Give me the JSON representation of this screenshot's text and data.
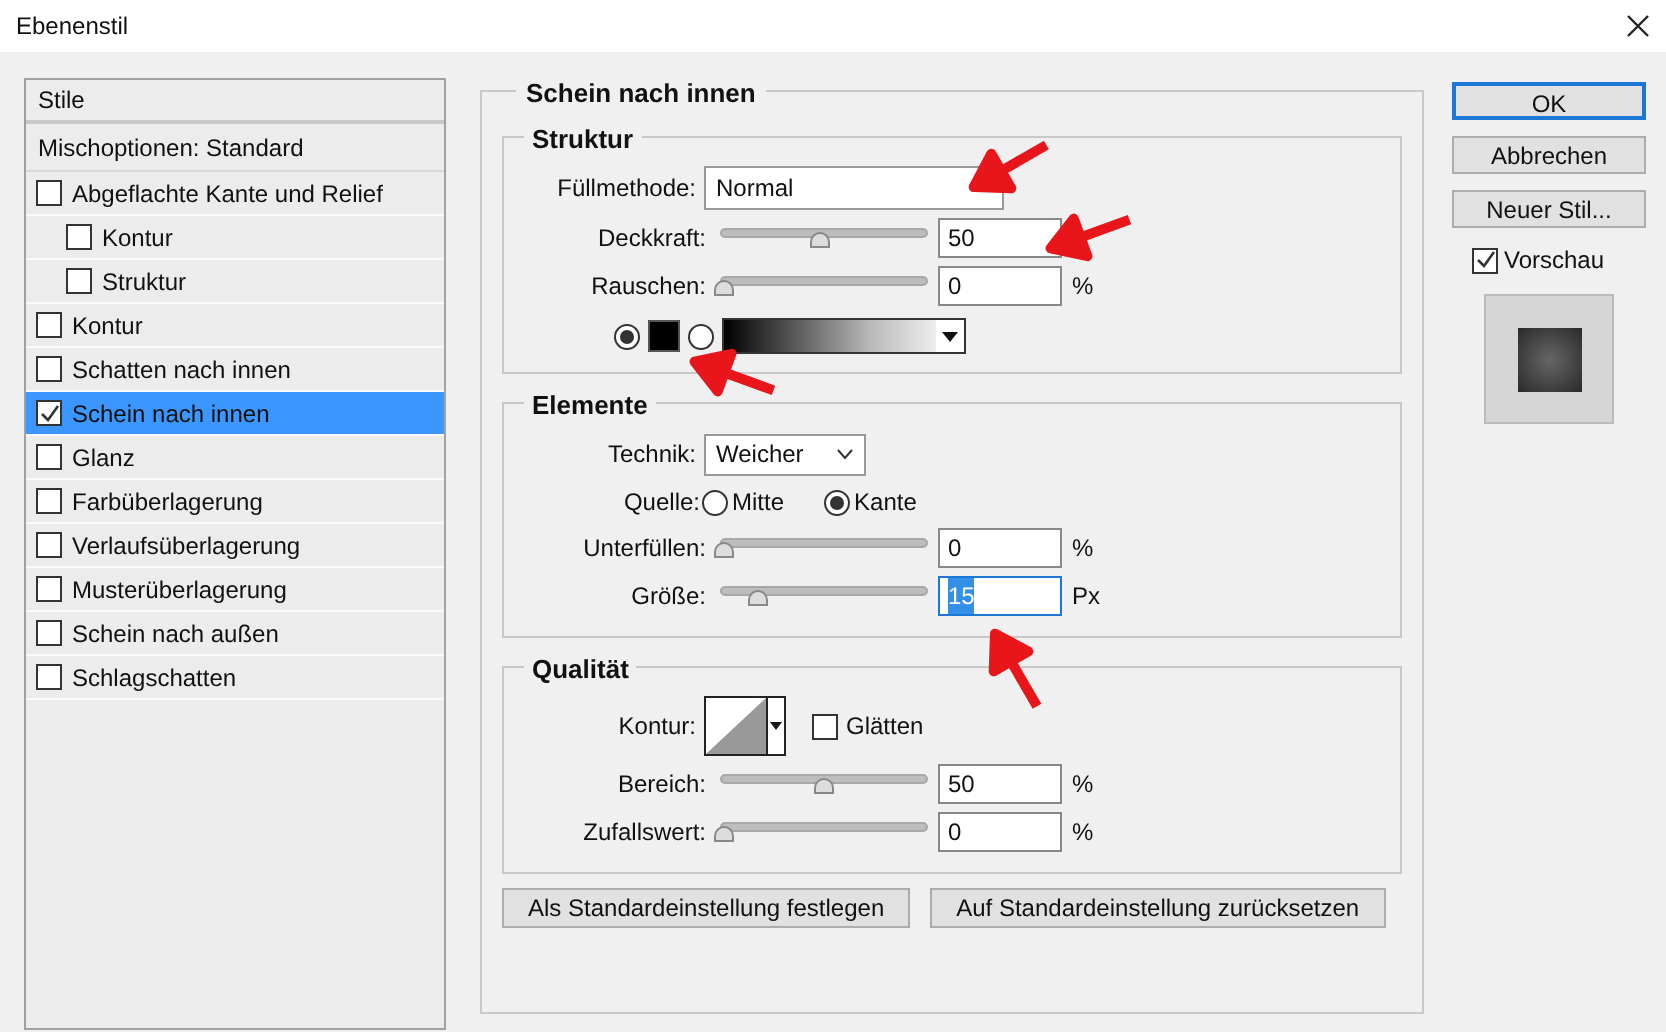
{
  "window": {
    "title": "Ebenenstil"
  },
  "styles_list": {
    "header": "Stile",
    "blend_options": "Mischoptionen: Standard",
    "items": [
      {
        "label": "Abgeflachte Kante und Relief",
        "checked": false,
        "selected": false,
        "children": [
          {
            "label": "Kontur",
            "checked": false,
            "selected": false
          },
          {
            "label": "Struktur",
            "checked": false,
            "selected": false
          }
        ]
      },
      {
        "label": "Kontur",
        "checked": false,
        "selected": false
      },
      {
        "label": "Schatten nach innen",
        "checked": false,
        "selected": false
      },
      {
        "label": "Schein nach innen",
        "checked": true,
        "selected": true
      },
      {
        "label": "Glanz",
        "checked": false,
        "selected": false
      },
      {
        "label": "Farbüberlagerung",
        "checked": false,
        "selected": false
      },
      {
        "label": "Verlaufsüberlagerung",
        "checked": false,
        "selected": false
      },
      {
        "label": "Musterüberlagerung",
        "checked": false,
        "selected": false
      },
      {
        "label": "Schein nach außen",
        "checked": false,
        "selected": false
      },
      {
        "label": "Schlagschatten",
        "checked": false,
        "selected": false
      }
    ]
  },
  "section_title": "Schein nach innen",
  "struktur": {
    "title": "Struktur",
    "blend_mode": {
      "label": "Füllmethode:",
      "value": "Normal"
    },
    "opacity": {
      "label": "Deckkraft:",
      "level": 0.48,
      "value": "50"
    },
    "noise": {
      "label": "Rauschen:",
      "level": 0,
      "value": "0",
      "unit": "%"
    },
    "fill_options": [
      {
        "kind": "color",
        "selected": true
      },
      {
        "kind": "gradient",
        "selected": false
      }
    ]
  },
  "elemente": {
    "title": "Elemente",
    "technique": {
      "label": "Technik:",
      "value": "Weicher"
    },
    "source": {
      "label": "Quelle:",
      "options": [
        {
          "label": "Mitte",
          "selected": false
        },
        {
          "label": "Kante",
          "selected": true
        }
      ]
    },
    "choke": {
      "label": "Unterfüllen:",
      "level": 0,
      "value": "0",
      "unit": "%",
      "focused": false
    },
    "size": {
      "label": "Größe:",
      "level": 0.17,
      "value": "15",
      "unit": "Px",
      "focused": true
    }
  },
  "qualitaet": {
    "title": "Qualität",
    "contour": {
      "label": "Kontur:"
    },
    "anti_alias": {
      "label": "Glätten",
      "checked": false
    },
    "range": {
      "label": "Bereich:",
      "level": 0.5,
      "value": "50",
      "unit": "%",
      "focused": false
    },
    "jitter": {
      "label": "Zufallswert:",
      "level": 0,
      "value": "0",
      "unit": "%",
      "focused": false
    }
  },
  "footer_buttons": [
    "Als Standardeinstellung festlegen",
    "Auf Standardeinstellung zurücksetzen"
  ],
  "actions": [
    {
      "label": "OK",
      "default": true
    },
    {
      "label": "Abbrechen",
      "default": false
    },
    {
      "label": "Neuer Stil...",
      "default": false
    }
  ],
  "preview": {
    "label": "Vorschau",
    "checked": true
  }
}
